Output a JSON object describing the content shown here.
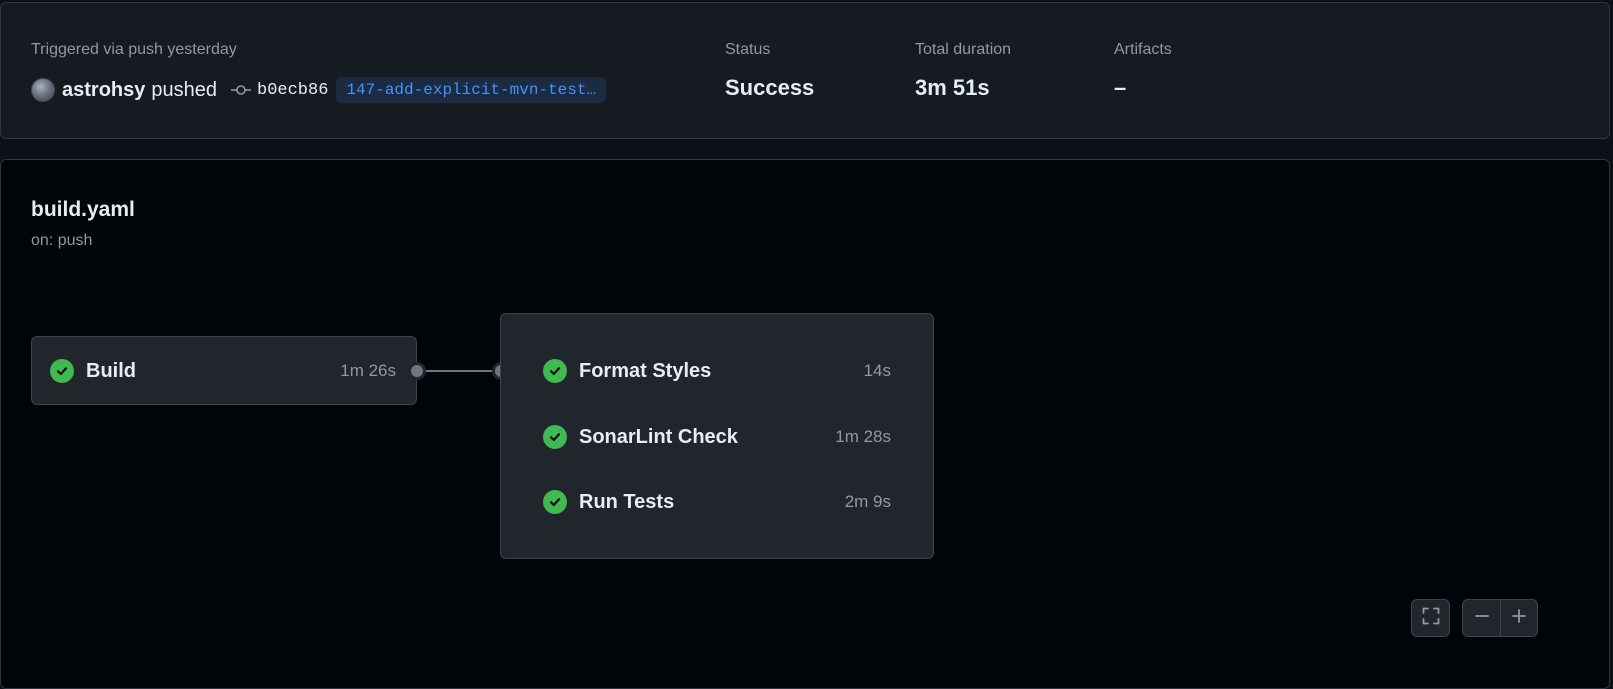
{
  "summary": {
    "trigger_text": "Triggered via push yesterday",
    "username": "astrohsy",
    "action": "pushed",
    "commit_sha": "b0ecb86",
    "branch": "147-add-explicit-mvn-test…",
    "status_label": "Status",
    "status_value": "Success",
    "duration_label": "Total duration",
    "duration_value": "3m 51s",
    "artifacts_label": "Artifacts",
    "artifacts_value": "–"
  },
  "workflow": {
    "name": "build.yaml",
    "trigger": "on: push"
  },
  "jobs": {
    "build": {
      "name": "Build",
      "time": "1m 26s",
      "status": "success"
    },
    "group": [
      {
        "name": "Format Styles",
        "time": "14s",
        "status": "success"
      },
      {
        "name": "SonarLint Check",
        "time": "1m 28s",
        "status": "success"
      },
      {
        "name": "Run Tests",
        "time": "2m 9s",
        "status": "success"
      }
    ]
  },
  "colors": {
    "success": "#3fb950",
    "accent": "#4493f8",
    "background": "#0d1117"
  },
  "icons": {
    "commit": "git-commit-icon",
    "check": "check-circle-icon",
    "fullscreen": "fullscreen-icon",
    "zoom_out": "minus-icon",
    "zoom_in": "plus-icon"
  }
}
